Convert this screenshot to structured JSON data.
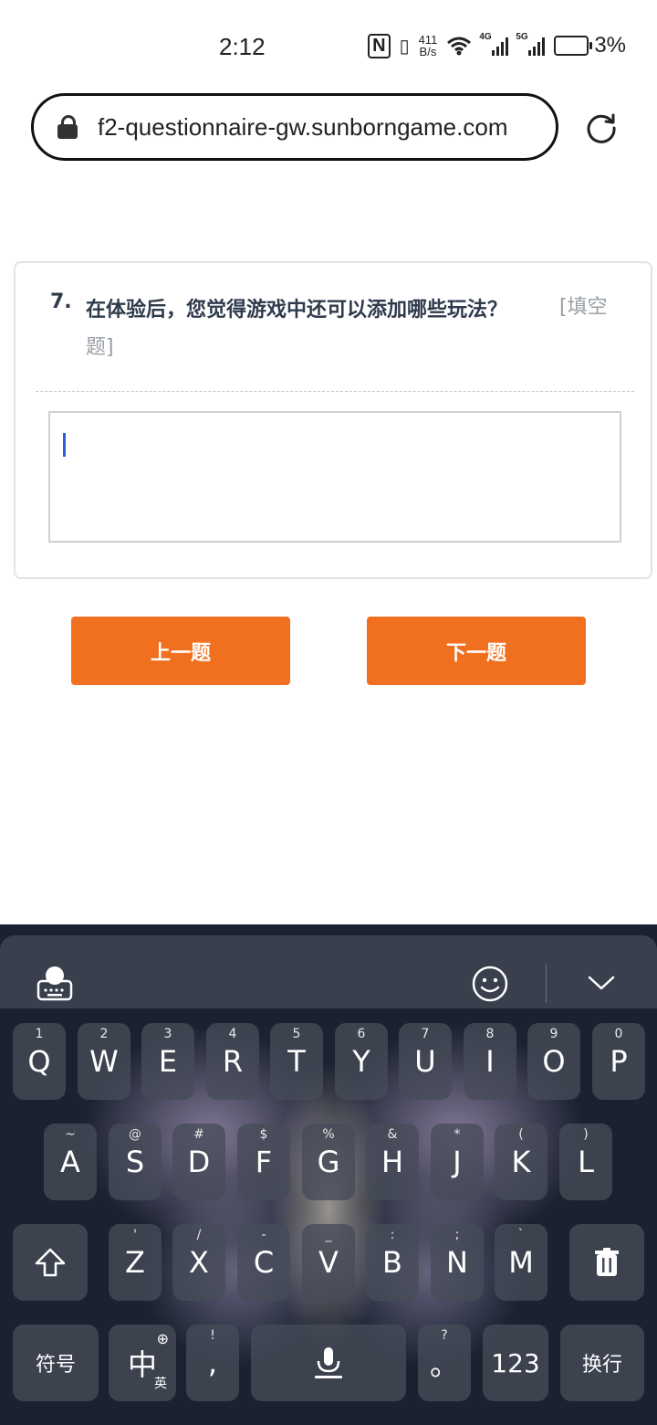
{
  "status": {
    "time": "2:12",
    "net_speed_value": "411",
    "net_speed_unit": "B/s",
    "sim1_tag": "4G",
    "sim2_tag": "5G",
    "battery_percent": "3%"
  },
  "browser": {
    "url": "f2-questionnaire-gw.sunborngame.com"
  },
  "question": {
    "number": "7.",
    "text": "在体验后，您觉得游戏中还可以添加哪些玩法？",
    "type_part1": "[填空",
    "type_part2": "题]",
    "answer_value": ""
  },
  "nav": {
    "prev_label": "上一题",
    "next_label": "下一题"
  },
  "keyboard": {
    "row1": [
      {
        "main": "Q",
        "sub": "1"
      },
      {
        "main": "W",
        "sub": "2"
      },
      {
        "main": "E",
        "sub": "3"
      },
      {
        "main": "R",
        "sub": "4"
      },
      {
        "main": "T",
        "sub": "5"
      },
      {
        "main": "Y",
        "sub": "6"
      },
      {
        "main": "U",
        "sub": "7"
      },
      {
        "main": "I",
        "sub": "8"
      },
      {
        "main": "O",
        "sub": "9"
      },
      {
        "main": "P",
        "sub": "0"
      }
    ],
    "row2": [
      {
        "main": "A",
        "sub": "~"
      },
      {
        "main": "S",
        "sub": "@"
      },
      {
        "main": "D",
        "sub": "#"
      },
      {
        "main": "F",
        "sub": "$"
      },
      {
        "main": "G",
        "sub": "%"
      },
      {
        "main": "H",
        "sub": "&"
      },
      {
        "main": "J",
        "sub": "*"
      },
      {
        "main": "K",
        "sub": "("
      },
      {
        "main": "L",
        "sub": ")"
      }
    ],
    "row3": [
      {
        "main": "Z",
        "sub": "'"
      },
      {
        "main": "X",
        "sub": "/"
      },
      {
        "main": "C",
        "sub": "-"
      },
      {
        "main": "V",
        "sub": "_"
      },
      {
        "main": "B",
        "sub": ":"
      },
      {
        "main": "N",
        "sub": ";"
      },
      {
        "main": "M",
        "sub": "`"
      }
    ],
    "symbols_label": "符号",
    "lang_label": "中",
    "lang_sub": "英",
    "comma_label": ",",
    "comma_sub": "!",
    "period_label": "。",
    "period_sub": "?",
    "numbers_label": "123",
    "enter_label": "换行"
  }
}
